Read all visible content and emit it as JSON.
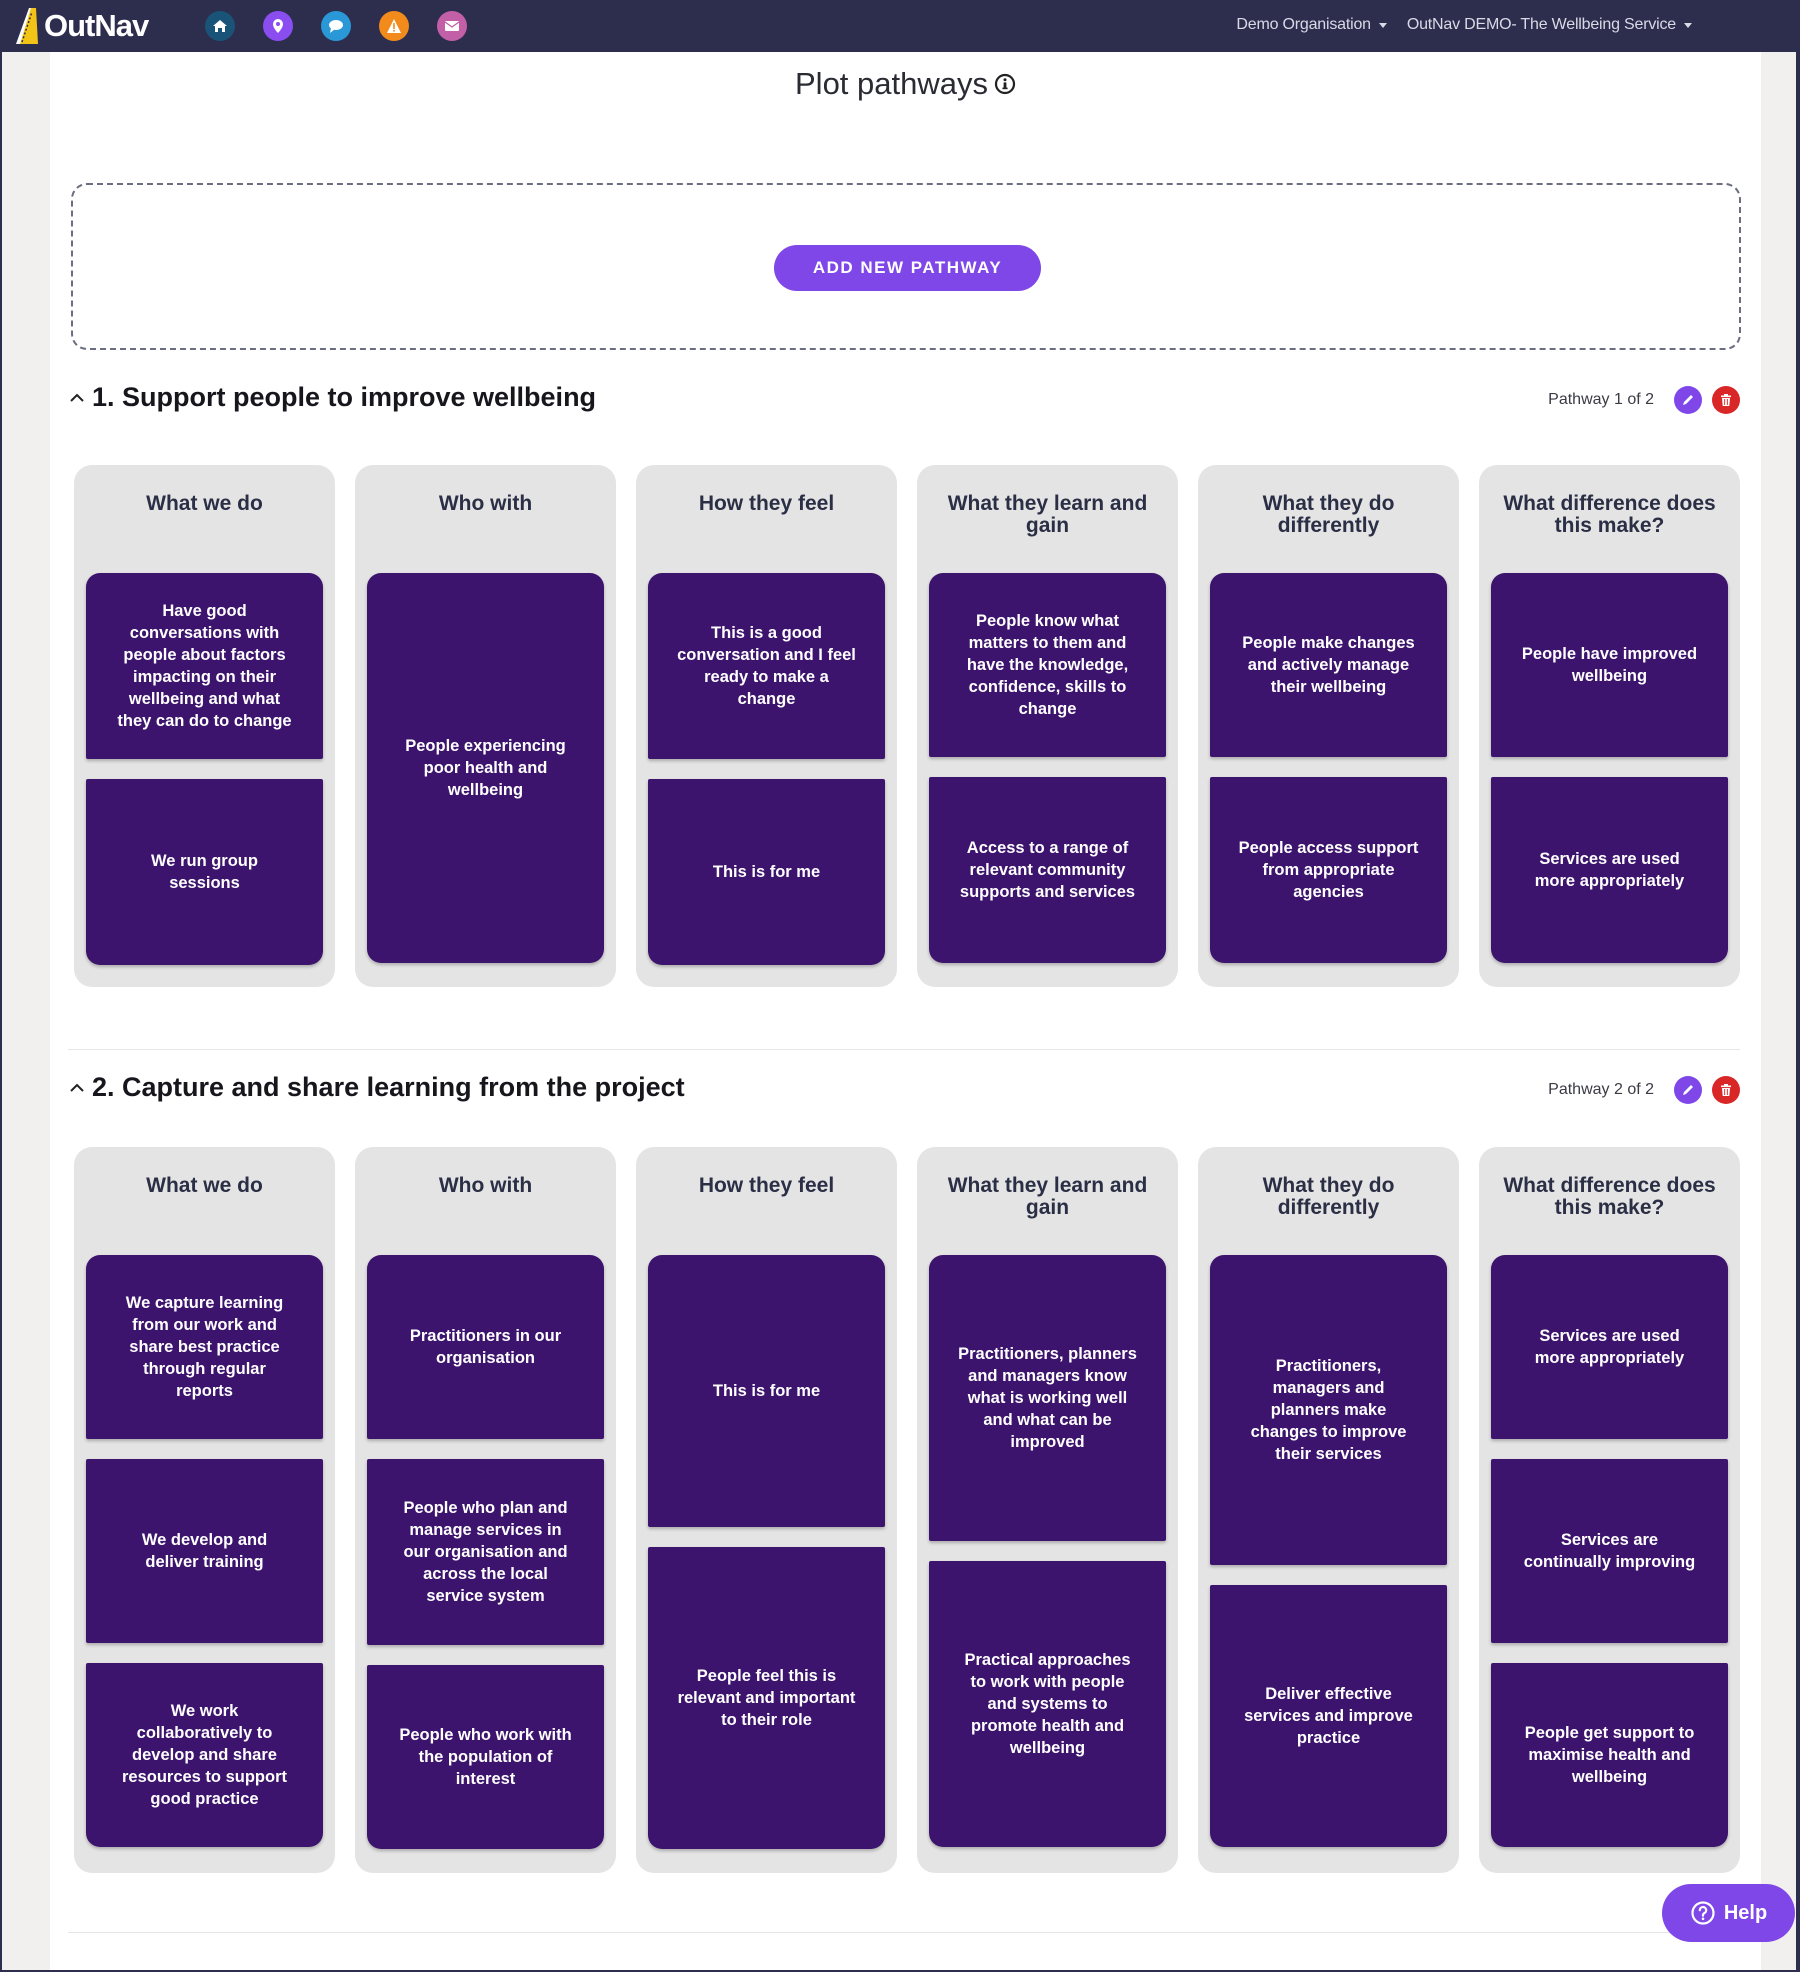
{
  "navbar": {
    "logo_text": "OutNav",
    "icons": [
      {
        "name": "home-icon",
        "color": "#1a5378"
      },
      {
        "name": "map-pin-icon",
        "color": "#8a4ef0"
      },
      {
        "name": "chat-icon",
        "color": "#2a98d6"
      },
      {
        "name": "warning-icon",
        "color": "#f28a1c"
      },
      {
        "name": "mail-icon",
        "color": "#c25fa6"
      }
    ],
    "organisation_dropdown": "Demo Organisation",
    "project_dropdown": "OutNav DEMO- The Wellbeing Service"
  },
  "page": {
    "title": "Plot pathways",
    "add_pathway_label": "ADD NEW PATHWAY",
    "help_label": "Help"
  },
  "colors": {
    "accent": "#7f47e8",
    "card": "#3d146d",
    "delete": "#d92626",
    "navbar": "#2d2e4e",
    "column_bg": "#e4e4e4"
  },
  "pathways": [
    {
      "title": "1. Support people to improve wellbeing",
      "count_label": "Pathway 1 of 2",
      "columns": [
        {
          "header": "What we do",
          "cards": [
            "Have good conversations with people about factors impacting on their wellbeing and what they can do to change",
            "We run group sessions"
          ]
        },
        {
          "header": "Who with",
          "cards": [
            "People experiencing poor health and wellbeing"
          ]
        },
        {
          "header": "How they feel",
          "cards": [
            "This is a good conversation and I feel ready to make a change",
            "This is for me"
          ]
        },
        {
          "header": "What they learn and gain",
          "cards": [
            "People know what matters to them and have the knowledge, confidence, skills to change",
            "Access to a range of relevant community supports and services"
          ]
        },
        {
          "header": "What they do differently",
          "cards": [
            "People make changes and actively manage their wellbeing",
            "People access support from appropriate agencies"
          ]
        },
        {
          "header": "What difference does this make?",
          "cards": [
            "People have improved wellbeing",
            "Services are used more appropriately"
          ]
        }
      ]
    },
    {
      "title": "2. Capture and share learning from the project",
      "count_label": "Pathway 2 of 2",
      "columns": [
        {
          "header": "What we do",
          "cards": [
            "We capture learning from our work and share best practice through regular reports",
            "We develop and deliver training",
            "We work collaboratively to develop and share resources to support good practice"
          ]
        },
        {
          "header": "Who with",
          "cards": [
            "Practitioners in our organisation",
            "People who plan and manage services in our organisation and across the local service system",
            "People who work with the population of interest"
          ]
        },
        {
          "header": "How they feel",
          "cards": [
            "This is for me",
            "People feel this is relevant and important to their role"
          ]
        },
        {
          "header": "What they learn and gain",
          "cards": [
            "Practitioners, planners and managers know what is working well and what can be improved",
            "Practical approaches to work with people and systems to promote health and wellbeing"
          ]
        },
        {
          "header": "What they do differently",
          "cards": [
            "Practitioners, managers and planners make changes to improve their services",
            "Deliver effective services and improve practice"
          ]
        },
        {
          "header": "What difference does this make?",
          "cards": [
            "Services are used more appropriately",
            "Services are continually improving",
            "People get support to maximise health and wellbeing"
          ]
        }
      ]
    }
  ]
}
